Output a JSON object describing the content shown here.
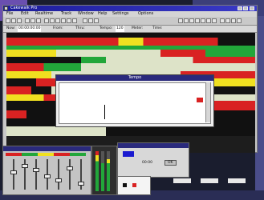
{
  "window": {
    "title": "Cakewalk Pro",
    "menu": [
      "File",
      "Edit",
      "Realtime",
      "Track",
      "Window",
      "Help",
      "Settings",
      "Options"
    ]
  },
  "status": {
    "now_label": "Now:",
    "now_value": "00:00:00:00",
    "from_label": "From:",
    "thru_label": "Thru:",
    "tempo_label": "Tempo:",
    "tempo_value": "120",
    "meter_label": "Meter:",
    "time_label": "Time:"
  },
  "dialog": {
    "title": "Tempo"
  },
  "bottom": {
    "meter_value": "00:00",
    "ok_label": "OK"
  },
  "colors": {
    "track_red": "#d92222",
    "track_green": "#22a63a",
    "track_yellow": "#f0e020",
    "track_black": "#111111"
  }
}
